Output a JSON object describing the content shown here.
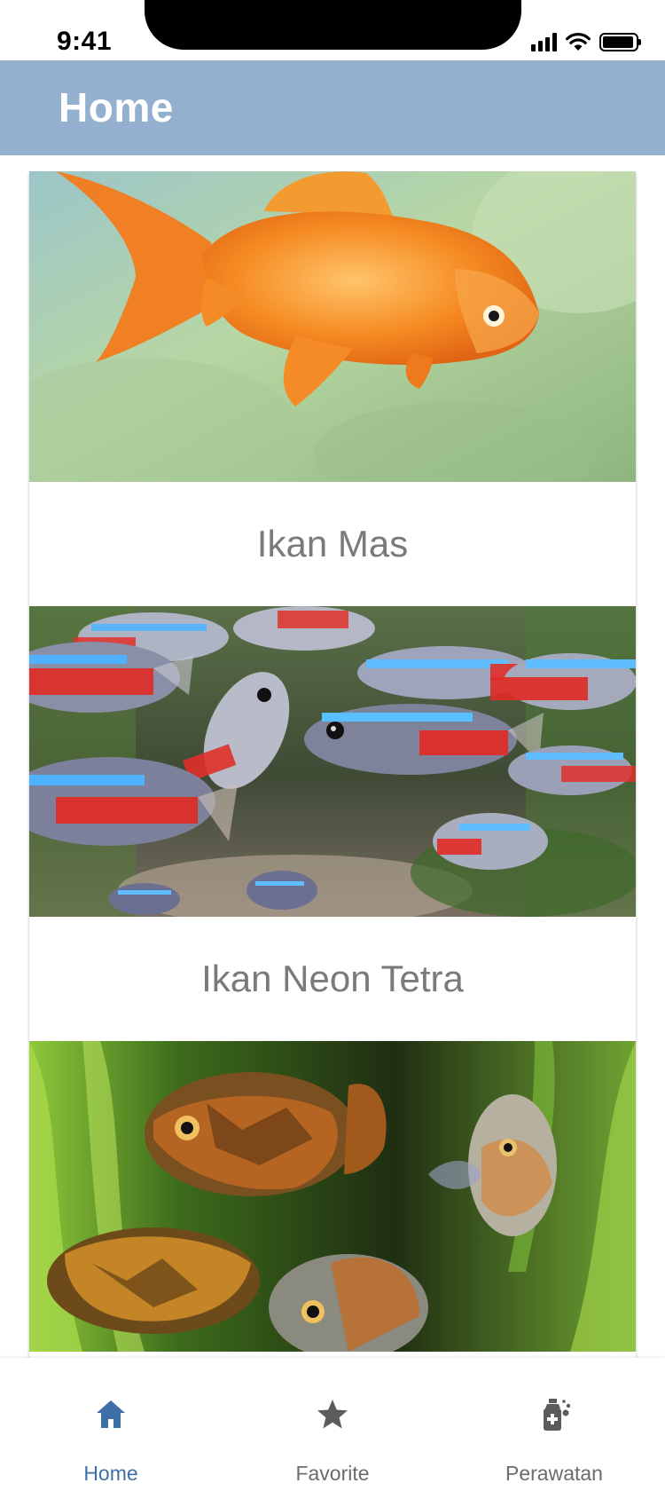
{
  "status_bar": {
    "time": "9:41"
  },
  "app_bar": {
    "title": "Home"
  },
  "cards": [
    {
      "label": "Ikan Mas"
    },
    {
      "label": "Ikan Neon Tetra"
    },
    {
      "label": ""
    }
  ],
  "bottom_nav": {
    "items": [
      {
        "label": "Home",
        "icon": "home-icon",
        "active": true
      },
      {
        "label": "Favorite",
        "icon": "star-icon",
        "active": false
      },
      {
        "label": "Perawatan",
        "icon": "spray-bottle-icon",
        "active": false
      }
    ]
  },
  "colors": {
    "app_bar": "#93b1cf",
    "active_nav": "#3f6fa8",
    "inactive_nav": "#6c6c6c"
  }
}
